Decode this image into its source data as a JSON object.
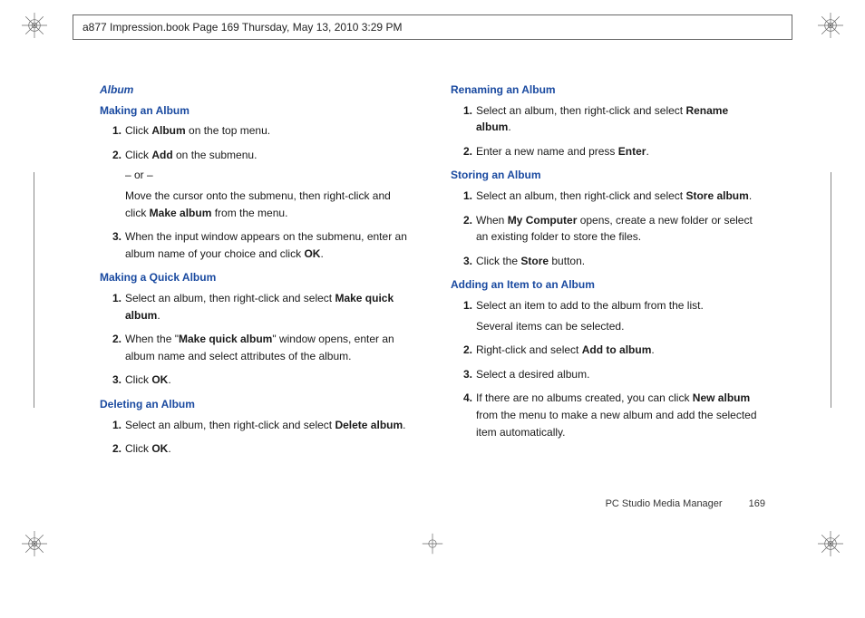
{
  "header": {
    "text": "a877 Impression.book  Page 169  Thursday, May 13, 2010  3:29 PM"
  },
  "left": {
    "title": "Album",
    "sec1": {
      "heading": "Making an Album",
      "s1_pre": "Click ",
      "s1_b": "Album",
      "s1_post": " on the top menu.",
      "s2_pre": "Click ",
      "s2_b": "Add",
      "s2_post": " on the submenu.",
      "s2_or": "– or –",
      "s2_alt_pre": "Move the cursor onto the submenu, then right-click and click ",
      "s2_alt_b": "Make album",
      "s2_alt_post": " from the menu.",
      "s3_pre": "When the input window appears on the submenu, enter an album name of your choice and click ",
      "s3_b": "OK",
      "s3_post": "."
    },
    "sec2": {
      "heading": "Making a Quick Album",
      "s1_pre": "Select an album, then right-click and select ",
      "s1_b": "Make quick album",
      "s1_post": ".",
      "s2_pre": "When the \"",
      "s2_b": "Make quick album",
      "s2_post": "\" window opens, enter an album name and select attributes of the album.",
      "s3_pre": "Click ",
      "s3_b": "OK",
      "s3_post": "."
    },
    "sec3": {
      "heading": "Deleting an Album",
      "s1_pre": "Select an album, then right-click and select ",
      "s1_b": "Delete album",
      "s1_post": ".",
      "s2_pre": "Click ",
      "s2_b": "OK",
      "s2_post": "."
    }
  },
  "right": {
    "sec1": {
      "heading": "Renaming an Album",
      "s1_pre": "Select an album, then right-click and select ",
      "s1_b": "Rename album",
      "s1_post": ".",
      "s2_pre": "Enter a new name and press ",
      "s2_b": "Enter",
      "s2_post": "."
    },
    "sec2": {
      "heading": "Storing an Album",
      "s1_pre": "Select an album, then right-click and select ",
      "s1_b": "Store album",
      "s1_post": ".",
      "s2_pre": "When ",
      "s2_b": "My Computer",
      "s2_post": " opens, create a new folder or select an existing folder to store the files.",
      "s3_pre": "Click the ",
      "s3_b": "Store",
      "s3_post": " button."
    },
    "sec3": {
      "heading": "Adding an Item to an Album",
      "s1": "Select an item to add to the album from the list.",
      "s1_note": "Several items can be selected.",
      "s2_pre": "Right-click and select ",
      "s2_b": "Add to album",
      "s2_post": ".",
      "s3": "Select a desired album.",
      "s4_pre": "If there are no albums created, you can click ",
      "s4_b": "New album",
      "s4_post": " from the menu to make a new album and add the selected item automatically."
    }
  },
  "footer": {
    "label": "PC Studio Media Manager",
    "page": "169"
  },
  "nums": {
    "n1": "1.",
    "n2": "2.",
    "n3": "3.",
    "n4": "4."
  }
}
